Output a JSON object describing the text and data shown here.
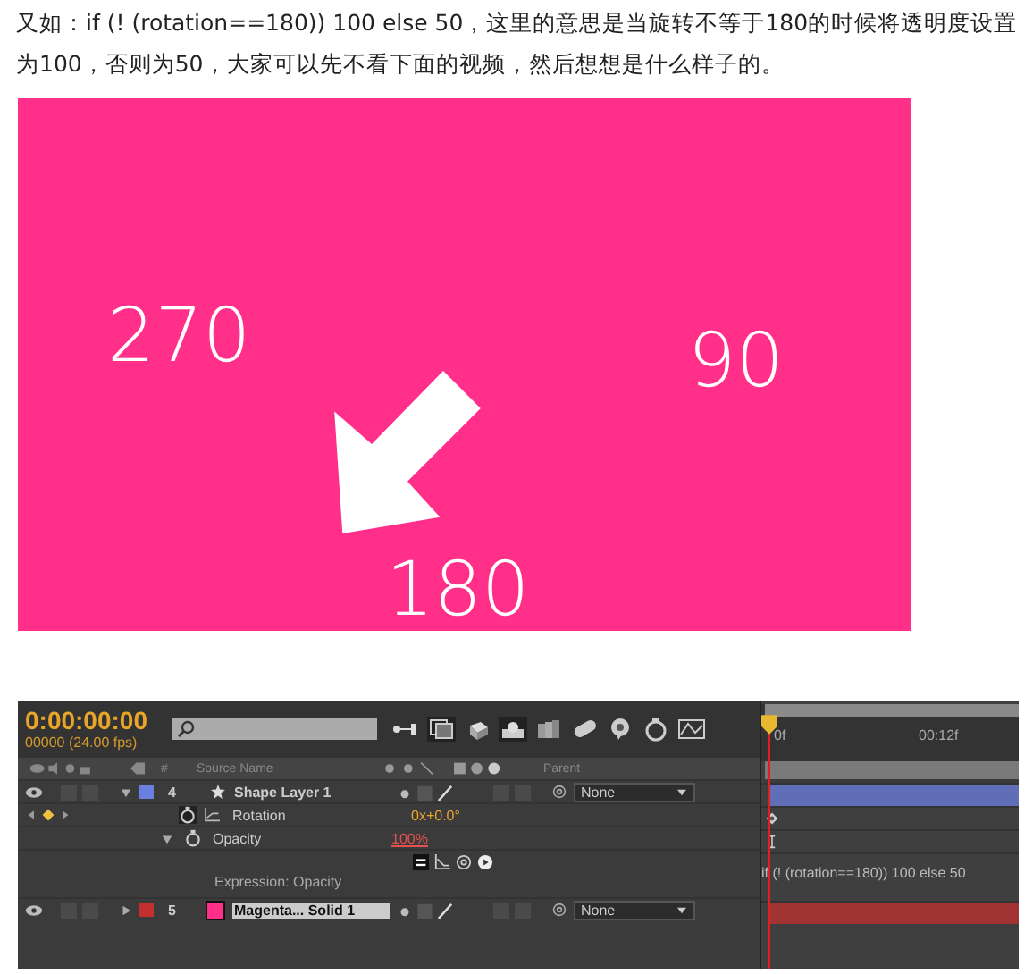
{
  "paragraph": "又如：if (! (rotation==180)) 100 else 50，这里的意思是当旋转不等于180的时候将透明度设置为100，否则为50，大家可以先不看下面的视频，然后想想是什么样子的。",
  "preview": {
    "labels": [
      "270",
      "90",
      "180"
    ]
  },
  "timeline": {
    "timecode": "0:00:00:00",
    "frame_info": "00000 (24.00 fps)",
    "number_header": "#",
    "source_header": "Source Name",
    "parent_header": "Parent",
    "ruler": [
      "0f",
      "00:12f"
    ],
    "rows": [
      {
        "kind": "layer",
        "number": "4",
        "solid": false,
        "name": "Shape Layer 1",
        "color": "#6b7fe0",
        "expanded": true,
        "selected": false,
        "parent": "None"
      },
      {
        "kind": "property",
        "name": "Rotation",
        "value": "0x+0.0°",
        "expression": false
      },
      {
        "kind": "property",
        "name": "Opacity",
        "value": "100%",
        "expression": true
      },
      {
        "kind": "expression",
        "label": "Expression: Opacity",
        "code": "if (! (rotation==180)) 100 else 50"
      },
      {
        "kind": "layer",
        "number": "5",
        "solid": true,
        "name": "Magenta... Solid 1",
        "color": "#c43030",
        "expanded": false,
        "selected": true,
        "parent": "None"
      }
    ]
  }
}
